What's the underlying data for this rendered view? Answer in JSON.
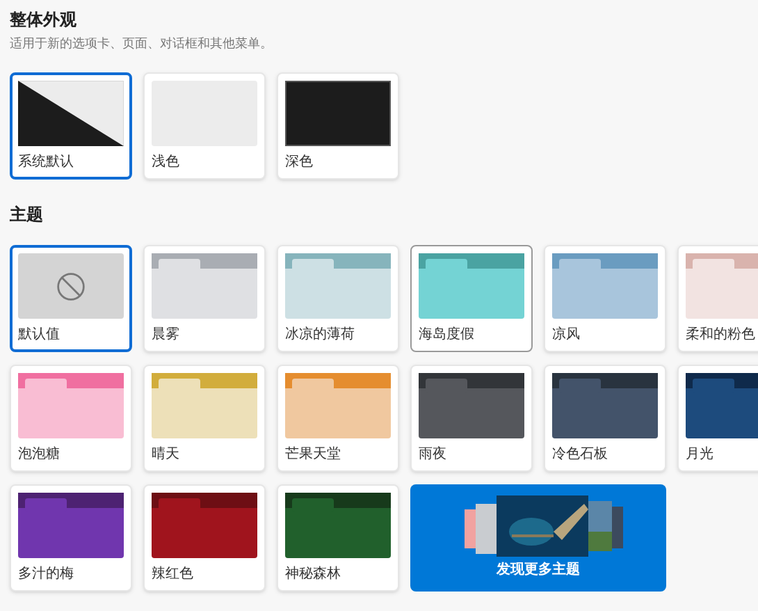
{
  "appearance": {
    "title": "整体外观",
    "description": "适用于新的选项卡、页面、对话框和其他菜单。",
    "options": [
      {
        "kind": "system",
        "label": "系统默认",
        "selected": true
      },
      {
        "kind": "light",
        "label": "浅色",
        "selected": false
      },
      {
        "kind": "dark",
        "label": "深色",
        "selected": false
      }
    ]
  },
  "themes": {
    "title": "主题",
    "items": [
      {
        "kind": "default",
        "label": "默认值",
        "selected": true,
        "outlined": false
      },
      {
        "kind": "folder",
        "label": "晨雾",
        "selected": false,
        "outlined": false,
        "swatches": [
          {
            "color": "#a9adb3"
          },
          {
            "color": "#dfe0e3"
          }
        ]
      },
      {
        "kind": "folder",
        "label": "冰凉的薄荷",
        "selected": false,
        "outlined": false,
        "swatches": [
          {
            "color": "#86b4bc"
          },
          {
            "color": "#cde0e4"
          }
        ]
      },
      {
        "kind": "folder",
        "label": "海岛度假",
        "selected": false,
        "outlined": true,
        "swatches": [
          {
            "color": "#4aa3a2"
          },
          {
            "color": "#74d3d4"
          }
        ]
      },
      {
        "kind": "folder",
        "label": "凉风",
        "selected": false,
        "outlined": false,
        "swatches": [
          {
            "color": "#6a9cc0"
          },
          {
            "color": "#a8c5dc"
          }
        ]
      },
      {
        "kind": "folder",
        "label": "柔和的粉色",
        "selected": false,
        "outlined": false,
        "swatches": [
          {
            "color": "#d9b3ad"
          },
          {
            "color": "#f2e3e1"
          }
        ]
      },
      {
        "kind": "folder",
        "label": "泡泡糖",
        "selected": false,
        "outlined": false,
        "swatches": [
          {
            "color": "#f06fa0"
          },
          {
            "color": "#f9bdd3"
          }
        ]
      },
      {
        "kind": "folder",
        "label": "晴天",
        "selected": false,
        "outlined": false,
        "swatches": [
          {
            "color": "#d2ad3c"
          },
          {
            "color": "#ede0b8"
          }
        ]
      },
      {
        "kind": "folder",
        "label": "芒果天堂",
        "selected": false,
        "outlined": false,
        "swatches": [
          {
            "color": "#e58d2f"
          },
          {
            "color": "#f0c89f"
          }
        ]
      },
      {
        "kind": "folder",
        "label": "雨夜",
        "selected": false,
        "outlined": false,
        "swatches": [
          {
            "color": "#323539"
          },
          {
            "color": "#55575c"
          }
        ]
      },
      {
        "kind": "folder",
        "label": "冷色石板",
        "selected": false,
        "outlined": false,
        "swatches": [
          {
            "color": "#29333f"
          },
          {
            "color": "#43536a"
          }
        ]
      },
      {
        "kind": "folder",
        "label": "月光",
        "selected": false,
        "outlined": false,
        "swatches": [
          {
            "color": "#0f2a4b"
          },
          {
            "color": "#1d4b7d"
          }
        ]
      },
      {
        "kind": "folder",
        "label": "多汁的梅",
        "selected": false,
        "outlined": false,
        "swatches": [
          {
            "color": "#4d2272"
          },
          {
            "color": "#7036ae"
          }
        ]
      },
      {
        "kind": "folder",
        "label": "辣红色",
        "selected": false,
        "outlined": false,
        "swatches": [
          {
            "color": "#6e0e14"
          },
          {
            "color": "#a0141d"
          }
        ]
      },
      {
        "kind": "folder",
        "label": "神秘森林",
        "selected": false,
        "outlined": false,
        "swatches": [
          {
            "color": "#173a1b"
          },
          {
            "color": "#21602c"
          }
        ]
      },
      {
        "kind": "promo",
        "label": "发现更多主题"
      }
    ]
  }
}
